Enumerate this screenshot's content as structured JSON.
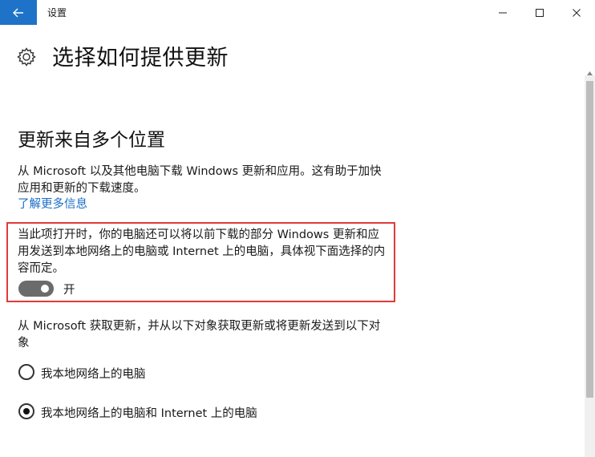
{
  "titlebar": {
    "app_title": "设置",
    "icons": {
      "back": "back-arrow-icon",
      "minimize": "minimize-icon",
      "maximize": "maximize-icon",
      "close": "close-icon"
    },
    "accent_color": "#1e73c8"
  },
  "header": {
    "icon": "gear-icon",
    "title": "选择如何提供更新"
  },
  "section": {
    "title": "更新来自多个位置",
    "description": "从 Microsoft 以及其他电脑下载 Windows 更新和应用。这有助于加快应用和更新的下载速度。",
    "learn_more": "了解更多信息"
  },
  "toggle_block": {
    "description": "当此项打开时，你的电脑还可以将以前下载的部分 Windows 更新和应用发送到本地网络上的电脑或 Internet 上的电脑，具体视下面选择的内容而定。",
    "toggle_on": true,
    "toggle_label": "开",
    "highlight_color": "#e03a3a"
  },
  "source": {
    "description": "从 Microsoft 获取更新，并从以下对象获取更新或将更新发送到以下对象",
    "options": [
      {
        "label": "我本地网络上的电脑",
        "selected": false
      },
      {
        "label": "我本地网络上的电脑和 Internet 上的电脑",
        "selected": true
      }
    ]
  },
  "link_color": "#1a6cc6"
}
